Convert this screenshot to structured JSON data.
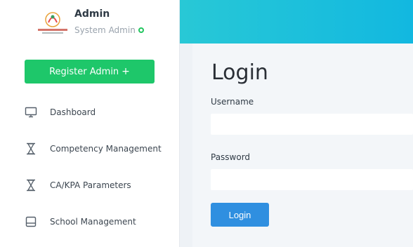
{
  "user": {
    "name": "Admin",
    "role": "System Admin"
  },
  "sidebar": {
    "register_button": "Register Admin",
    "register_icon": "plus-icon",
    "items": [
      {
        "label": "Dashboard",
        "icon": "monitor-icon"
      },
      {
        "label": "Competency Management",
        "icon": "hourglass-icon"
      },
      {
        "label": "CA/KPA Parameters",
        "icon": "hourglass-icon"
      },
      {
        "label": "School Management",
        "icon": "tray-icon"
      }
    ]
  },
  "login": {
    "title": "Login",
    "username_label": "Username",
    "username_value": "",
    "password_label": "Password",
    "password_value": "",
    "submit_label": "Login"
  },
  "colors": {
    "accent_green": "#1ec76a",
    "topbar_start": "#28c8d6",
    "topbar_end": "#12b8e0",
    "button_blue": "#2f8fe0",
    "status_online": "#22c55e"
  }
}
